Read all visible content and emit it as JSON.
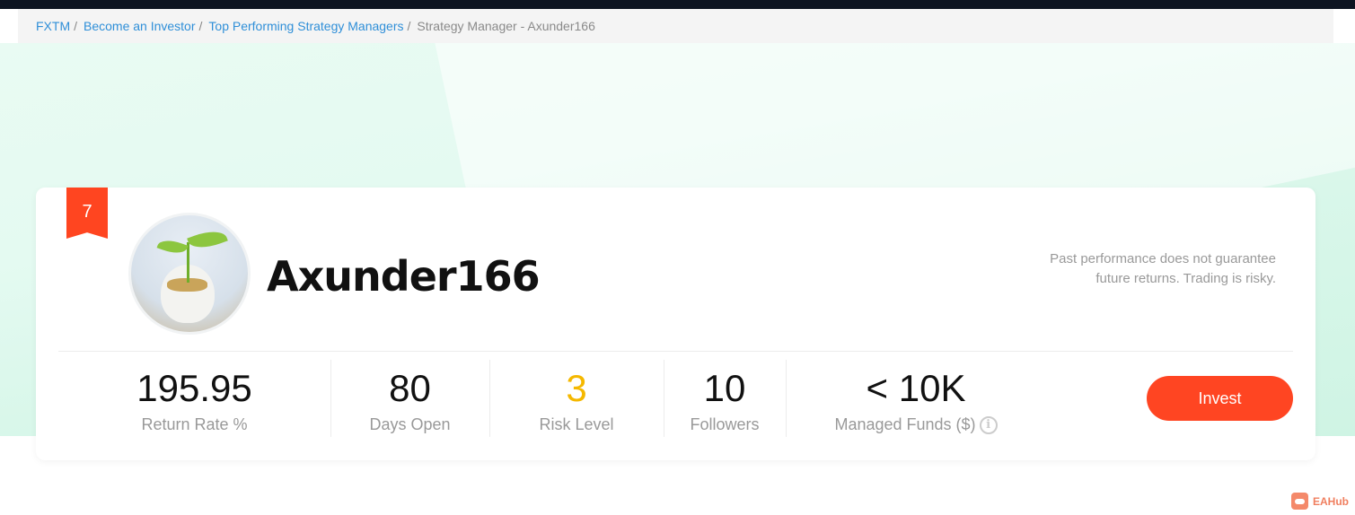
{
  "breadcrumb": [
    {
      "label": "FXTM"
    },
    {
      "label": "Become an Investor"
    },
    {
      "label": "Top Performing Strategy Managers"
    },
    {
      "label": "Strategy Manager - Axunder166"
    }
  ],
  "separator": "/",
  "manager": {
    "rank": "7",
    "name": "Axunder166",
    "disclaimer_line1": "Past performance does not guarantee",
    "disclaimer_line2": "future returns. Trading is risky."
  },
  "stats": [
    {
      "value": "195.95",
      "label": "Return Rate %"
    },
    {
      "value": "80",
      "label": "Days Open"
    },
    {
      "value": "3",
      "label": "Risk Level"
    },
    {
      "value": "10",
      "label": "Followers"
    },
    {
      "value": "< 10K",
      "label": "Managed Funds ($)"
    }
  ],
  "info_glyph": "i",
  "invest_label": "Invest",
  "watermark": "EAHub",
  "colors": {
    "accent": "#ff4522",
    "risk": "#f5b800",
    "link": "#2f8fd8"
  }
}
